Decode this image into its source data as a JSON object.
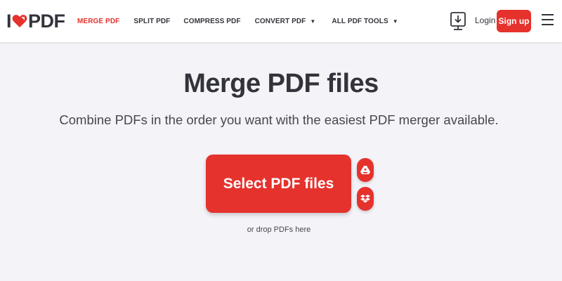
{
  "header": {
    "logo": {
      "left": "I",
      "right": "PDF"
    },
    "nav": [
      {
        "label": "MERGE PDF",
        "active": true
      },
      {
        "label": "SPLIT PDF"
      },
      {
        "label": "COMPRESS PDF"
      },
      {
        "label": "CONVERT PDF",
        "dropdown": true
      },
      {
        "label": "ALL PDF TOOLS",
        "dropdown": true
      }
    ],
    "dropdown_caret": "▼",
    "login_label": "Login",
    "signup_label": "Sign up"
  },
  "main": {
    "title": "Merge PDF files",
    "subtitle": "Combine PDFs in the order you want with the easiest PDF merger available.",
    "select_button_label": "Select PDF files",
    "drop_hint": "or drop PDFs here",
    "cloud_buttons": [
      "google-drive-icon",
      "dropbox-icon"
    ]
  },
  "colors": {
    "accent": "#e5322d",
    "text": "#33333b",
    "background": "#f4f3f8"
  }
}
